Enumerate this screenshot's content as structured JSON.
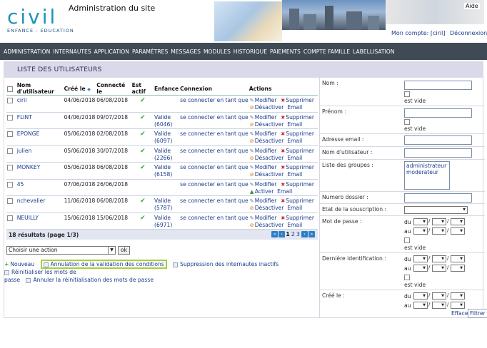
{
  "header": {
    "logo_word": "civil",
    "logo_sub": "ENFANCE - EDUCATION",
    "title": "Administration du site",
    "aide": "Aide",
    "account": "Mon compte: [ciril]",
    "logout": "Déconnexion"
  },
  "nav": [
    "Administration",
    "Internautes",
    "Application",
    "Paramètres",
    "Messages",
    "Modules",
    "Historique",
    "Paiements",
    "Compte Famille",
    "Labellisation"
  ],
  "page_title": "LISTE DES UTILISATEURS",
  "table": {
    "columns": [
      "Nom d'utilisateur",
      "Créé le",
      "Connecté le",
      "Est actif",
      "Enfance",
      "Connexion",
      "Actions"
    ],
    "rows": [
      {
        "name": "ciril",
        "created": "04/06/2018",
        "connected": "06/08/2018",
        "active": "✔",
        "enf1": "",
        "enf2": "",
        "conn": "se connecter en tant que",
        "a1": "Modifier",
        "a2": "Supprimer",
        "a3": "Désactiver",
        "a4": "Email"
      },
      {
        "name": "FLINT",
        "created": "04/06/2018",
        "connected": "09/07/2018",
        "active": "✔",
        "enf1": "Valide",
        "enf2": "(6046)",
        "conn": "se connecter en tant que",
        "a1": "Modifier",
        "a2": "Supprimer",
        "a3": "Désactiver",
        "a4": "Email"
      },
      {
        "name": "EPONGE",
        "created": "05/06/2018",
        "connected": "02/08/2018",
        "active": "✔",
        "enf1": "Valide",
        "enf2": "(6097)",
        "conn": "se connecter en tant que",
        "a1": "Modifier",
        "a2": "Supprimer",
        "a3": "Désactiver",
        "a4": "Email"
      },
      {
        "name": "julien",
        "created": "05/06/2018",
        "connected": "30/07/2018",
        "active": "✔",
        "enf1": "Valide",
        "enf2": "(2266)",
        "conn": "se connecter en tant que",
        "a1": "Modifier",
        "a2": "Supprimer",
        "a3": "Désactiver",
        "a4": "Email"
      },
      {
        "name": "MONKEY",
        "created": "05/06/2018",
        "connected": "06/08/2018",
        "active": "✔",
        "enf1": "Valide",
        "enf2": "(6158)",
        "conn": "se connecter en tant que",
        "a1": "Modifier",
        "a2": "Supprimer",
        "a3": "Désactiver",
        "a4": "Email"
      },
      {
        "name": "45",
        "created": "07/06/2018",
        "connected": "26/06/2018",
        "active": "",
        "enf1": "",
        "enf2": "",
        "conn": "se connecter en tant que",
        "a1": "Modifier",
        "a2": "Supprimer",
        "a3": "Activer",
        "a4": "Email"
      },
      {
        "name": "nchevalier",
        "created": "11/06/2018",
        "connected": "06/08/2018",
        "active": "✔",
        "enf1": "Valide",
        "enf2": "(5787)",
        "conn": "se connecter en tant que",
        "a1": "Modifier",
        "a2": "Supprimer",
        "a3": "Désactiver",
        "a4": "Email"
      },
      {
        "name": "NEUILLY",
        "created": "15/06/2018",
        "connected": "15/06/2018",
        "active": "✔",
        "enf1": "Valide",
        "enf2": "(6971)",
        "conn": "se connecter en tant que",
        "a1": "Modifier",
        "a2": "Supprimer",
        "a3": "Désactiver",
        "a4": "Email"
      }
    ],
    "results": "18 résultats (page 1/3)",
    "pages": [
      "1",
      "2",
      "3"
    ]
  },
  "bulk": {
    "select": "Choisir une action",
    "ok": "ok"
  },
  "links": {
    "nouveau": "Nouveau",
    "annulation": "Annulation de la validation des conditions",
    "suppression": "Suppression des internautes inactifs",
    "reinit1": "Réinitialiser les mots de",
    "reinit2": "passe",
    "annuler": "Annuler la réinitialisation des mots de passe"
  },
  "filters": {
    "nom": "Nom :",
    "prenom": "Prénom :",
    "email": "Adresse email :",
    "username": "Nom d'utilisateur :",
    "groupes": "Liste des groupes :",
    "groupes_options": [
      "administrateur",
      "moderateur"
    ],
    "dossier": "Numero dossier :",
    "souscription": "Etat de la souscription :",
    "mdp": "Mot de passe :",
    "derniere": "Dernière identification :",
    "cree": "Créé le :",
    "est_vide": "est vide",
    "du": "du",
    "au": "au",
    "sep": "/",
    "effacer": "Effacer",
    "filtrer": "Filtrer"
  }
}
